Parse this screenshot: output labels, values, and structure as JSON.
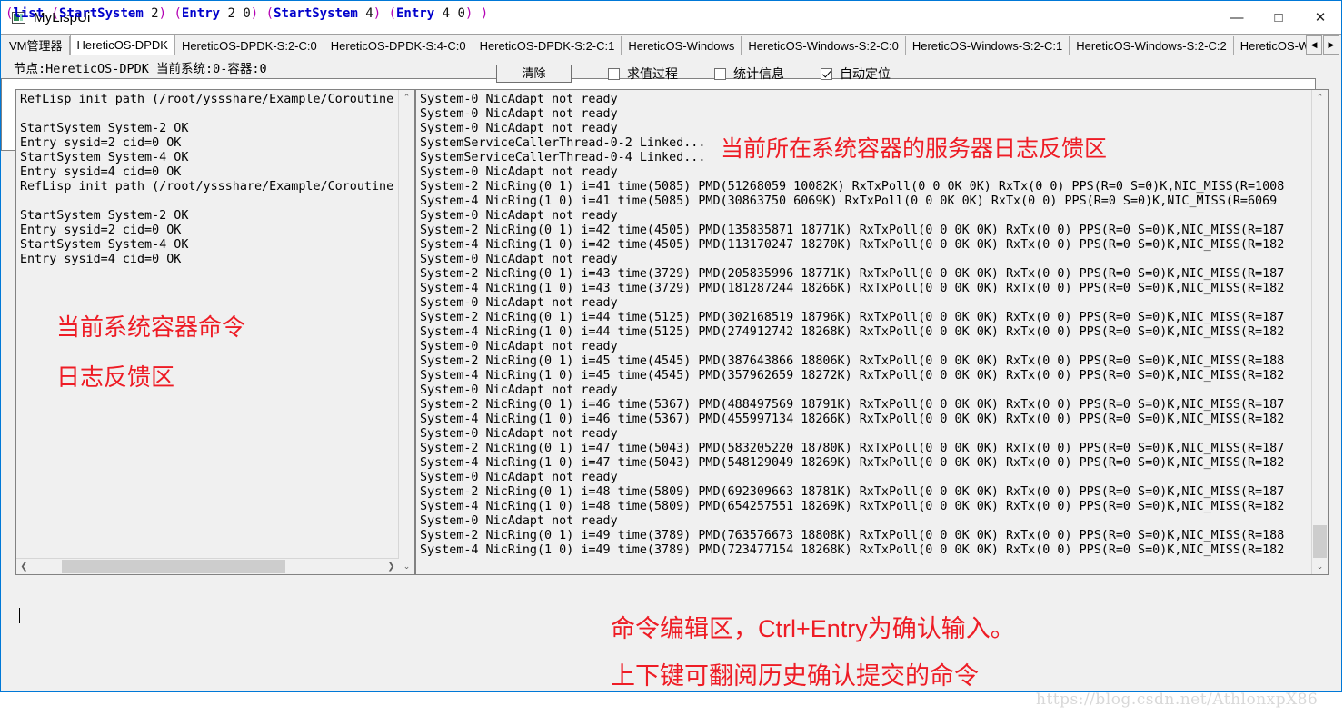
{
  "window": {
    "title": "MyLispUi",
    "icon": "app-window-icon",
    "controls": {
      "minimize": "—",
      "maximize": "□",
      "close": "✕"
    }
  },
  "tabs": {
    "items": [
      {
        "label": "VM管理器",
        "active": false
      },
      {
        "label": "HereticOS-DPDK",
        "active": true
      },
      {
        "label": "HereticOS-DPDK-S:2-C:0",
        "active": false
      },
      {
        "label": "HereticOS-DPDK-S:4-C:0",
        "active": false
      },
      {
        "label": "HereticOS-DPDK-S:2-C:1",
        "active": false
      },
      {
        "label": "HereticOS-Windows",
        "active": false
      },
      {
        "label": "HereticOS-Windows-S:2-C:0",
        "active": false
      },
      {
        "label": "HereticOS-Windows-S:2-C:1",
        "active": false
      },
      {
        "label": "HereticOS-Windows-S:2-C:2",
        "active": false
      },
      {
        "label": "HereticOS-Windo",
        "active": false
      }
    ],
    "scroll_left": "◀",
    "scroll_right": "▶"
  },
  "statusbar": {
    "node_prefix": "节点:",
    "node_name": "HereticOS-DPDK",
    "current_label": "当前系统:",
    "current_system": "0",
    "container_label": "-容器:",
    "current_container": "0",
    "full_text": "节点:HereticOS-DPDK 当前系统:0-容器:0"
  },
  "toolbar": {
    "clear_label": "清除",
    "checkboxes": [
      {
        "label": "求值过程",
        "checked": false
      },
      {
        "label": "统计信息",
        "checked": false
      },
      {
        "label": "自动定位",
        "checked": true
      }
    ]
  },
  "left_log": {
    "lines": [
      "RefLisp init path (/root/yssshare/Example/Coroutine",
      "",
      "StartSystem System-2 OK",
      "Entry sysid=2 cid=0 OK",
      "StartSystem System-4 OK",
      "Entry sysid=4 cid=0 OK",
      "RefLisp init path (/root/yssshare/Example/Coroutine",
      "",
      "StartSystem System-2 OK",
      "Entry sysid=2 cid=0 OK",
      "StartSystem System-4 OK",
      "Entry sysid=4 cid=0 OK"
    ]
  },
  "right_log": {
    "lines": [
      "System-0 NicAdapt not ready",
      "System-0 NicAdapt not ready",
      "System-0 NicAdapt not ready",
      "SystemServiceCallerThread-0-2 Linked...",
      "SystemServiceCallerThread-0-4 Linked...",
      "System-0 NicAdapt not ready",
      "System-2 NicRing(0 1) i=41 time(5085) PMD(51268059 10082K) RxTxPoll(0 0 0K 0K) RxTx(0 0) PPS(R=0 S=0)K,NIC_MISS(R=1008",
      "System-4 NicRing(1 0) i=41 time(5085) PMD(30863750 6069K) RxTxPoll(0 0 0K 0K) RxTx(0 0) PPS(R=0 S=0)K,NIC_MISS(R=6069",
      "System-0 NicAdapt not ready",
      "System-2 NicRing(0 1) i=42 time(4505) PMD(135835871 18771K) RxTxPoll(0 0 0K 0K) RxTx(0 0) PPS(R=0 S=0)K,NIC_MISS(R=187",
      "System-4 NicRing(1 0) i=42 time(4505) PMD(113170247 18270K) RxTxPoll(0 0 0K 0K) RxTx(0 0) PPS(R=0 S=0)K,NIC_MISS(R=182",
      "System-0 NicAdapt not ready",
      "System-2 NicRing(0 1) i=43 time(3729) PMD(205835996 18771K) RxTxPoll(0 0 0K 0K) RxTx(0 0) PPS(R=0 S=0)K,NIC_MISS(R=187",
      "System-4 NicRing(1 0) i=43 time(3729) PMD(181287244 18266K) RxTxPoll(0 0 0K 0K) RxTx(0 0) PPS(R=0 S=0)K,NIC_MISS(R=182",
      "System-0 NicAdapt not ready",
      "System-2 NicRing(0 1) i=44 time(5125) PMD(302168519 18796K) RxTxPoll(0 0 0K 0K) RxTx(0 0) PPS(R=0 S=0)K,NIC_MISS(R=187",
      "System-4 NicRing(1 0) i=44 time(5125) PMD(274912742 18268K) RxTxPoll(0 0 0K 0K) RxTx(0 0) PPS(R=0 S=0)K,NIC_MISS(R=182",
      "System-0 NicAdapt not ready",
      "System-2 NicRing(0 1) i=45 time(4545) PMD(387643866 18806K) RxTxPoll(0 0 0K 0K) RxTx(0 0) PPS(R=0 S=0)K,NIC_MISS(R=188",
      "System-4 NicRing(1 0) i=45 time(4545) PMD(357962659 18272K) RxTxPoll(0 0 0K 0K) RxTx(0 0) PPS(R=0 S=0)K,NIC_MISS(R=182",
      "System-0 NicAdapt not ready",
      "System-2 NicRing(0 1) i=46 time(5367) PMD(488497569 18791K) RxTxPoll(0 0 0K 0K) RxTx(0 0) PPS(R=0 S=0)K,NIC_MISS(R=187",
      "System-4 NicRing(1 0) i=46 time(5367) PMD(455997134 18266K) RxTxPoll(0 0 0K 0K) RxTx(0 0) PPS(R=0 S=0)K,NIC_MISS(R=182",
      "System-0 NicAdapt not ready",
      "System-2 NicRing(0 1) i=47 time(5043) PMD(583205220 18780K) RxTxPoll(0 0 0K 0K) RxTx(0 0) PPS(R=0 S=0)K,NIC_MISS(R=187",
      "System-4 NicRing(1 0) i=47 time(5043) PMD(548129049 18269K) RxTxPoll(0 0 0K 0K) RxTx(0 0) PPS(R=0 S=0)K,NIC_MISS(R=182",
      "System-0 NicAdapt not ready",
      "System-2 NicRing(0 1) i=48 time(5809) PMD(692309663 18781K) RxTxPoll(0 0 0K 0K) RxTx(0 0) PPS(R=0 S=0)K,NIC_MISS(R=187",
      "System-4 NicRing(1 0) i=48 time(5809) PMD(654257551 18269K) RxTxPoll(0 0 0K 0K) RxTx(0 0) PPS(R=0 S=0)K,NIC_MISS(R=182",
      "System-0 NicAdapt not ready",
      "System-2 NicRing(0 1) i=49 time(3789) PMD(763576673 18808K) RxTxPoll(0 0 0K 0K) RxTx(0 0) PPS(R=0 S=0)K,NIC_MISS(R=188",
      "System-4 NicRing(1 0) i=49 time(3789) PMD(723477154 18268K) RxTxPoll(0 0 0K 0K) RxTx(0 0) PPS(R=0 S=0)K,NIC_MISS(R=182"
    ]
  },
  "command_editor": {
    "value": "(list (StartSystem 2) (Entry 2 0) (StartSystem 4) (Entry 4 0) )",
    "tokens": [
      {
        "t": "(",
        "k": "paren"
      },
      {
        "t": "list",
        "k": "sym"
      },
      {
        "t": " ",
        "k": "plain"
      },
      {
        "t": "(",
        "k": "paren"
      },
      {
        "t": "StartSystem",
        "k": "sym"
      },
      {
        "t": " 2",
        "k": "num"
      },
      {
        "t": ")",
        "k": "paren"
      },
      {
        "t": " ",
        "k": "plain"
      },
      {
        "t": "(",
        "k": "paren"
      },
      {
        "t": "Entry",
        "k": "sym"
      },
      {
        "t": " 2 0",
        "k": "num"
      },
      {
        "t": ")",
        "k": "paren"
      },
      {
        "t": " ",
        "k": "plain"
      },
      {
        "t": "(",
        "k": "paren"
      },
      {
        "t": "StartSystem",
        "k": "sym"
      },
      {
        "t": " 4",
        "k": "num"
      },
      {
        "t": ")",
        "k": "paren"
      },
      {
        "t": " ",
        "k": "plain"
      },
      {
        "t": "(",
        "k": "paren"
      },
      {
        "t": "Entry",
        "k": "sym"
      },
      {
        "t": " 4 0",
        "k": "num"
      },
      {
        "t": ")",
        "k": "paren"
      },
      {
        "t": " ",
        "k": "plain"
      },
      {
        "t": ")",
        "k": "paren"
      }
    ]
  },
  "annotations": {
    "right_log": "当前所在系统容器的服务器日志反馈区",
    "left_log_line1": "当前系统容器命令",
    "left_log_line2": "日志反馈区",
    "cmd_line1": "命令编辑区，Ctrl+Entry为确认输入。",
    "cmd_line2": "上下键可翻阅历史确认提交的命令",
    "color": "#ee1c25"
  },
  "watermark": {
    "text": "https://blog.csdn.net/AthlonxpX86"
  },
  "scrollbars": {
    "up_arrow": "⌃",
    "down_arrow": "⌄",
    "left_arrow": "❮",
    "right_arrow": "❯"
  }
}
